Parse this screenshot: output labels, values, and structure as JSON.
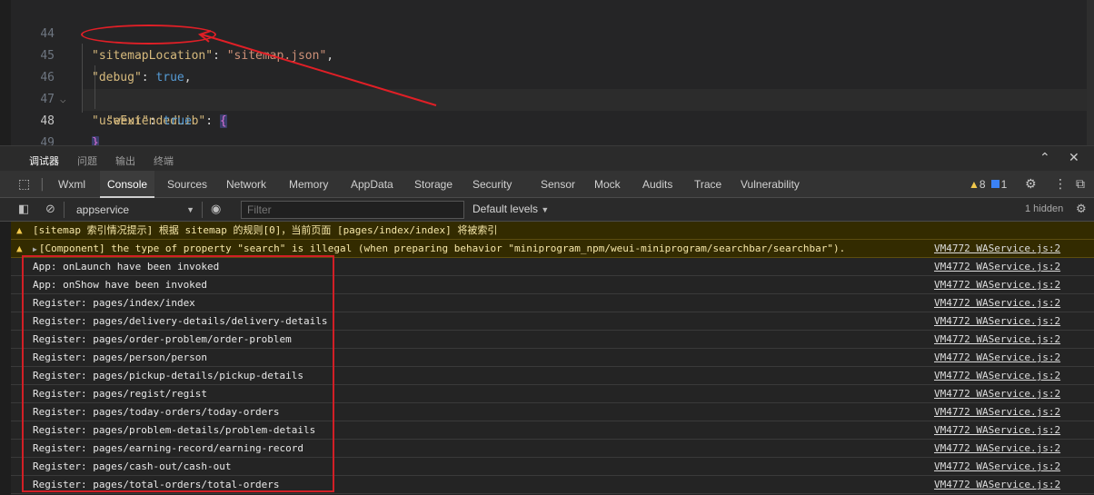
{
  "editor": {
    "lines": [
      {
        "num": "44",
        "key": "\"sitemapLocation\"",
        "colon": ": ",
        "value": "\"sitemap.json\"",
        "tail": ","
      },
      {
        "num": "45",
        "key": "\"debug\"",
        "colon": ": ",
        "value": "true",
        "tail": ","
      },
      {
        "num": "46",
        "key": "\"useExtendedLib\"",
        "colon": ": ",
        "value": "{",
        "tail": ""
      },
      {
        "num": "47",
        "key": "\"weui\"",
        "colon": ": ",
        "value": "true",
        "tail": ""
      },
      {
        "num": "48",
        "brace": "}"
      },
      {
        "num": "49",
        "brace": "}"
      }
    ]
  },
  "panel": {
    "tabs": [
      "调试器",
      "问题",
      "输出",
      "终端"
    ],
    "collapse_icon": "chevron-up-icon",
    "close_icon": "close-icon"
  },
  "devtools": {
    "tabs": [
      "Wxml",
      "Console",
      "Sources",
      "Network",
      "Memory",
      "AppData",
      "Storage",
      "Security",
      "Sensor",
      "Mock",
      "Audits",
      "Trace",
      "Vulnerability"
    ],
    "active_tab": "Console",
    "warning_count": "8",
    "info_count": "1"
  },
  "console_toolbar": {
    "context": "appservice",
    "filter_placeholder": "Filter",
    "levels": "Default levels",
    "hidden": "1 hidden"
  },
  "messages": [
    {
      "type": "warn",
      "text": "[sitemap 索引情况提示] 根据 sitemap 的规则[0]，当前页面 [pages/index/index] 将被索引",
      "source": ""
    },
    {
      "type": "warn",
      "text": "[Component] the type of property \"search\" is illegal (when preparing behavior \"miniprogram_npm/weui-miniprogram/searchbar/searchbar\").",
      "source": "VM4772 WAService.js:2"
    },
    {
      "type": "log",
      "text": "App: onLaunch have been invoked",
      "source": "VM4772 WAService.js:2"
    },
    {
      "type": "log",
      "text": "App: onShow have been invoked",
      "source": "VM4772 WAService.js:2"
    },
    {
      "type": "log",
      "text": "Register: pages/index/index",
      "source": "VM4772 WAService.js:2"
    },
    {
      "type": "log",
      "text": "Register: pages/delivery-details/delivery-details",
      "source": "VM4772 WAService.js:2"
    },
    {
      "type": "log",
      "text": "Register: pages/order-problem/order-problem",
      "source": "VM4772 WAService.js:2"
    },
    {
      "type": "log",
      "text": "Register: pages/person/person",
      "source": "VM4772 WAService.js:2"
    },
    {
      "type": "log",
      "text": "Register: pages/pickup-details/pickup-details",
      "source": "VM4772 WAService.js:2"
    },
    {
      "type": "log",
      "text": "Register: pages/regist/regist",
      "source": "VM4772 WAService.js:2"
    },
    {
      "type": "log",
      "text": "Register: pages/today-orders/today-orders",
      "source": "VM4772 WAService.js:2"
    },
    {
      "type": "log",
      "text": "Register: pages/problem-details/problem-details",
      "source": "VM4772 WAService.js:2"
    },
    {
      "type": "log",
      "text": "Register: pages/earning-record/earning-record",
      "source": "VM4772 WAService.js:2"
    },
    {
      "type": "log",
      "text": "Register: pages/cash-out/cash-out",
      "source": "VM4772 WAService.js:2"
    },
    {
      "type": "log",
      "text": "Register: pages/total-orders/total-orders",
      "source": "VM4772 WAService.js:2"
    }
  ],
  "colors": {
    "annotation": "#e01f26",
    "warning_bg": "#332b00",
    "accent_warning": "#f2c94c"
  }
}
